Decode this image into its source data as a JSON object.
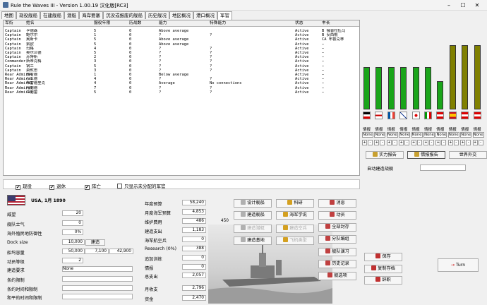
{
  "window": {
    "title": "Rule the Waves III - Version 1.00.19 汉化版[RC3]"
  },
  "tabs": [
    "地图",
    "现役舰船",
    "在建舰船",
    "潜艇",
    "海岸要塞",
    "沉没或报废的舰船",
    "历史舰况",
    "地区概况",
    "港口概况",
    "军官"
  ],
  "active_tab": 9,
  "officer_table": {
    "headers": [
      "军衔",
      "姓名",
      "服役年限",
      "历战数",
      "能力",
      "特殊能力",
      "状态",
      "丰长"
    ],
    "rows": [
      [
        "Captain",
        "亨德森",
        "5",
        "0",
        "Above average",
        "",
        "Active",
        "B 俄普拉伍马"
      ],
      [
        "Captain",
        "鲍尔尔",
        "1",
        "0",
        "?",
        "?",
        "Active",
        "B 安西根"
      ],
      [
        "Captain",
        "奥斯卡",
        "5",
        "0",
        "Above average",
        "",
        "Active",
        "CA 布鲁克林"
      ],
      [
        "Captain",
        "索欧",
        "5",
        "0",
        "Above average",
        "",
        "Active",
        "–"
      ],
      [
        "Captain",
        "玛格",
        "4",
        "0",
        "?",
        "?",
        "Active",
        "–"
      ],
      [
        "Captain",
        "奥尔兰德",
        "5",
        "0",
        "?",
        "?",
        "Active",
        "–"
      ],
      [
        "Captain",
        "苏博斯",
        "2",
        "0",
        "?",
        "?",
        "Active",
        "–"
      ],
      [
        "Commander",
        "斯蒂克梅",
        "3",
        "0",
        "?",
        "?",
        "Active",
        "–"
      ],
      [
        "Captain",
        "钢兰",
        "5",
        "0",
        "?",
        "?",
        "Active",
        "–"
      ],
      [
        "Captain",
        "萧默思",
        "3",
        "0",
        "?",
        "?",
        "Active",
        "–"
      ],
      [
        "Rear Admiral",
        "默哈德",
        "1",
        "0",
        "Below average",
        "",
        "Active",
        "–"
      ],
      [
        "Rear Admiral",
        "小亚德",
        "4",
        "0",
        "?",
        "?",
        "Active",
        "–"
      ],
      [
        "Rear Admiral",
        "布雷德里克",
        "4",
        "0",
        "Average",
        "No connections",
        "Active",
        "–"
      ],
      [
        "Rear Admiral",
        "阿德德",
        "7",
        "0",
        "?",
        "?",
        "Active",
        "–"
      ],
      [
        "Rear Admiral",
        "兰德雷",
        "5",
        "0",
        "?",
        "?",
        "Active",
        "–"
      ]
    ]
  },
  "strength_chart": {
    "type": "bar",
    "values": [
      48,
      48,
      48,
      48,
      48,
      48,
      32,
      73,
      73,
      73
    ],
    "colors": [
      "#1aa51a",
      "#1aa51a",
      "#1aa51a",
      "#1aa51a",
      "#1aa51a",
      "#1aa51a",
      "#1aa51a",
      "#808000",
      "#808000",
      "#808000"
    ],
    "nations": [
      "Germany",
      "UK",
      "France",
      "Russia",
      "Japan",
      "Italy",
      "Austria",
      "Spain",
      "Austria2"
    ],
    "intel_label": "情报",
    "intel_level": "None"
  },
  "checkboxes": [
    {
      "label": "现役",
      "checked": true
    },
    {
      "label": "退休",
      "checked": true
    },
    {
      "label": "阵亡",
      "checked": true
    },
    {
      "label": "只显示未分配的军官",
      "checked": false
    }
  ],
  "right_panel": {
    "power_report": "实力报告",
    "intel_report": "情报报告",
    "world_diplomacy": "世界外交",
    "auto_build": "自动建造战舰"
  },
  "nation": {
    "date": "USA, 1月 1890"
  },
  "stats_left": [
    {
      "label": "威望",
      "value": "20"
    },
    {
      "label": "舰队士气",
      "value": "0"
    },
    {
      "label": "海外殖民地防御性",
      "value": "0%"
    },
    {
      "label": "Dock size",
      "value": "10,000"
    },
    {
      "label": "船坞容量",
      "value": "50,000"
    },
    {
      "label": "动员等级",
      "value": "2"
    },
    {
      "label": "建造要求",
      "value": "None"
    },
    {
      "label": "条约限制",
      "value": ""
    },
    {
      "label": "条约时间和限制",
      "value": ""
    },
    {
      "label": "和平的时间和限制",
      "value": ""
    }
  ],
  "dock_button": "建造",
  "dock_extra": [
    "7,100",
    "42,900"
  ],
  "stats_mid": [
    {
      "label": "年度预算",
      "value": "58,240"
    },
    {
      "label": "月度海军预算",
      "value": "4,853"
    },
    {
      "label": "维护费用",
      "value": "486",
      "extra": "450"
    },
    {
      "label": "建造支出",
      "value": "1,183"
    },
    {
      "label": "海军航空兵",
      "value": "0"
    },
    {
      "label": "Research (0%)",
      "value": "388"
    },
    {
      "label": "追加训练",
      "value": "0"
    },
    {
      "label": "情报",
      "value": "0"
    },
    {
      "label": "总支出",
      "value": "2,057"
    },
    {
      "label": "月收支",
      "value": "2,796"
    },
    {
      "label": "资金",
      "value": "2,470"
    }
  ],
  "buttons_col1": [
    "设计舰船",
    "建造舰船",
    "建造潜艇",
    "建造基地"
  ],
  "buttons_col2": [
    "科研",
    "海军学说",
    "建造空兵",
    "飞机类型"
  ],
  "buttons_col3": [
    "消息",
    "动员",
    "全部封存",
    "分队编组",
    "舰队演习",
    "历史记录",
    "舰选项"
  ],
  "buttons_col4": [
    "保存",
    "复制存档",
    "辞职"
  ],
  "turn_button": "Turn"
}
